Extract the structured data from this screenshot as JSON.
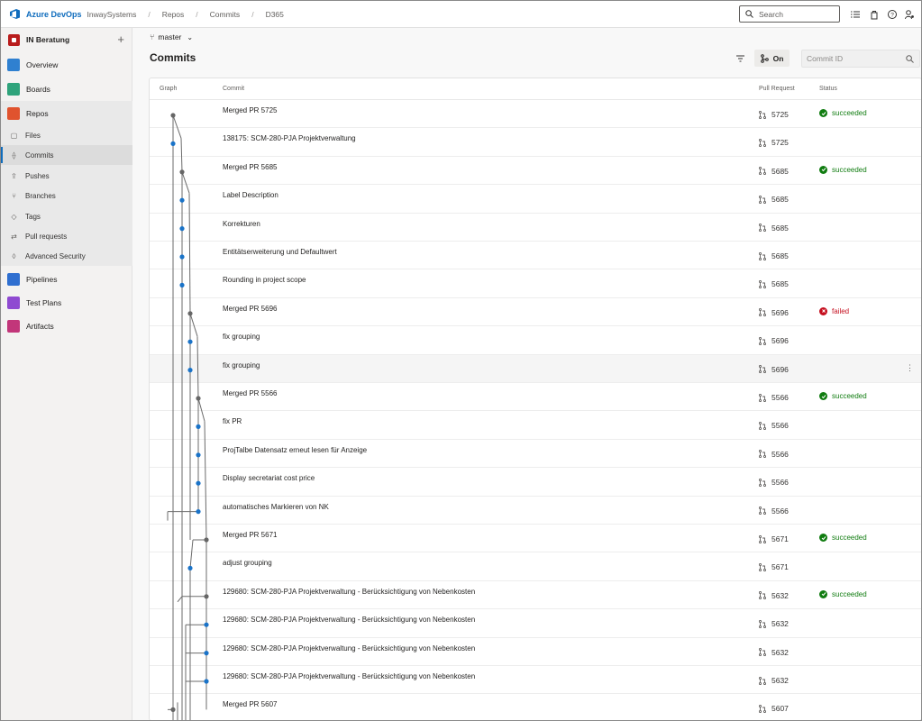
{
  "topbar": {
    "brand": "Azure DevOps",
    "breadcrumbs": [
      "InwaySystems",
      "Repos",
      "Commits",
      "D365"
    ],
    "search_placeholder": "Search"
  },
  "sidebar": {
    "org": "IN Beratung",
    "items": [
      {
        "label": "Overview",
        "color": "#2f80d0"
      },
      {
        "label": "Boards",
        "color": "#2fa37b"
      },
      {
        "label": "Repos",
        "color": "#e0532e"
      }
    ],
    "repo_items": [
      {
        "label": "Files"
      },
      {
        "label": "Commits"
      },
      {
        "label": "Pushes"
      },
      {
        "label": "Branches"
      },
      {
        "label": "Tags"
      },
      {
        "label": "Pull requests"
      },
      {
        "label": "Advanced Security"
      }
    ],
    "items_after": [
      {
        "label": "Pipelines",
        "color": "#2f6fd0"
      },
      {
        "label": "Test Plans",
        "color": "#8f4ad1"
      },
      {
        "label": "Artifacts",
        "color": "#c2367a"
      }
    ]
  },
  "main": {
    "branch": "master",
    "title": "Commits",
    "toggle_label": "On",
    "commit_search_placeholder": "Commit ID"
  },
  "table": {
    "headers": {
      "graph": "Graph",
      "commit": "Commit",
      "pr": "Pull Request",
      "status": "Status"
    },
    "rows": [
      {
        "message": "Merged PR 5725",
        "pr": "5725",
        "status": "succeeded"
      },
      {
        "message": "138175: SCM-280-PJA Projektverwaltung",
        "pr": "5725",
        "status": ""
      },
      {
        "message": "Merged PR 5685",
        "pr": "5685",
        "status": "succeeded"
      },
      {
        "message": "Label Description",
        "pr": "5685",
        "status": ""
      },
      {
        "message": "Korrekturen",
        "pr": "5685",
        "status": ""
      },
      {
        "message": "Entitätserweiterung und Defaultwert",
        "pr": "5685",
        "status": ""
      },
      {
        "message": "Rounding in project scope",
        "pr": "5685",
        "status": ""
      },
      {
        "message": "Merged PR 5696",
        "pr": "5696",
        "status": "failed"
      },
      {
        "message": "fix grouping",
        "pr": "5696",
        "status": ""
      },
      {
        "message": "fix grouping",
        "pr": "5696",
        "status": ""
      },
      {
        "message": "Merged PR 5566",
        "pr": "5566",
        "status": "succeeded"
      },
      {
        "message": "fix PR",
        "pr": "5566",
        "status": ""
      },
      {
        "message": "ProjTalbe Datensatz erneut lesen für Anzeige",
        "pr": "5566",
        "status": ""
      },
      {
        "message": "Display secretariat cost price",
        "pr": "5566",
        "status": ""
      },
      {
        "message": "automatisches Markieren von NK",
        "pr": "5566",
        "status": ""
      },
      {
        "message": "Merged PR 5671",
        "pr": "5671",
        "status": "succeeded"
      },
      {
        "message": "adjust grouping",
        "pr": "5671",
        "status": ""
      },
      {
        "message": "129680: SCM-280-PJA Projektverwaltung - Berücksichtigung von Nebenkosten",
        "pr": "5632",
        "status": "succeeded"
      },
      {
        "message": "129680: SCM-280-PJA Projektverwaltung - Berücksichtigung von Nebenkosten",
        "pr": "5632",
        "status": ""
      },
      {
        "message": "129680: SCM-280-PJA Projektverwaltung - Berücksichtigung von Nebenkosten",
        "pr": "5632",
        "status": ""
      },
      {
        "message": "129680: SCM-280-PJA Projektverwaltung - Berücksichtigung von Nebenkosten",
        "pr": "5632",
        "status": ""
      },
      {
        "message": "Merged PR 5607",
        "pr": "5607",
        "status": ""
      }
    ]
  },
  "colors": {
    "accent": "#0f6cbd",
    "success": "#107c10",
    "failed": "#c50f1f",
    "merge_node": "#666666",
    "commit_node": "#1a73c8"
  }
}
